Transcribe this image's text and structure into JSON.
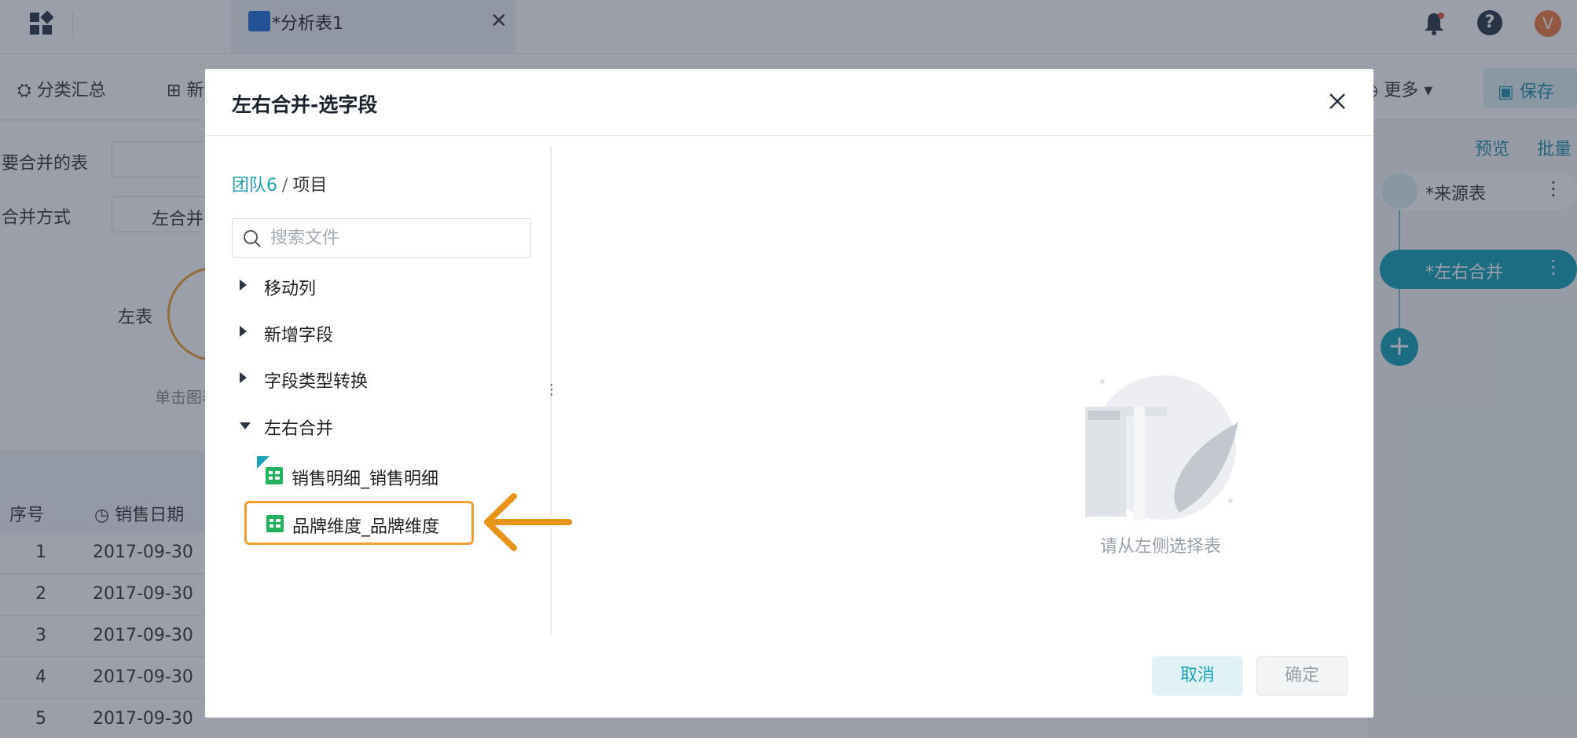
{
  "topbar": {
    "tab_title": "*分析表1",
    "avatar_letter": "V"
  },
  "toolbar": {
    "group_summary": "分类汇总",
    "new_partial": "新",
    "more": "更多",
    "save": "保存"
  },
  "left_panel": {
    "merge_table_label": "要合并的表",
    "merge_method_label": "合并方式",
    "merge_method_value": "左合并",
    "left_table_label": "左表",
    "hint_partial": "单击图表"
  },
  "right_panel": {
    "preview": "预览",
    "batch": "批量",
    "nodes": [
      {
        "label": "*来源表"
      },
      {
        "label": "*左右合并"
      }
    ]
  },
  "data_table": {
    "headers": [
      "序号",
      "销售日期"
    ],
    "rows": [
      [
        "1",
        "2017-09-30"
      ],
      [
        "2",
        "2017-09-30"
      ],
      [
        "3",
        "2017-09-30"
      ],
      [
        "4",
        "2017-09-30"
      ],
      [
        "5",
        "2017-09-30"
      ]
    ]
  },
  "modal": {
    "title": "左右合并-选字段",
    "breadcrumb": {
      "team": "团队6",
      "separator": "/",
      "project": "项目"
    },
    "search": {
      "placeholder": "搜索文件",
      "value": ""
    },
    "tree": [
      {
        "label": "移动列",
        "expanded": false
      },
      {
        "label": "新增字段",
        "expanded": false
      },
      {
        "label": "字段类型转换",
        "expanded": false
      },
      {
        "label": "左右合并",
        "expanded": true
      }
    ],
    "files": [
      {
        "label": "销售明细_销售明细",
        "icon": "table-icon"
      },
      {
        "label": "品牌维度_品牌维度",
        "icon": "table-icon",
        "highlighted": true
      }
    ],
    "empty_text": "请从左侧选择表",
    "cancel": "取消",
    "confirm": "确定"
  },
  "colors": {
    "accent": "#1aa2b8",
    "highlight": "#f0a030",
    "file_icon": "#22b15d"
  }
}
